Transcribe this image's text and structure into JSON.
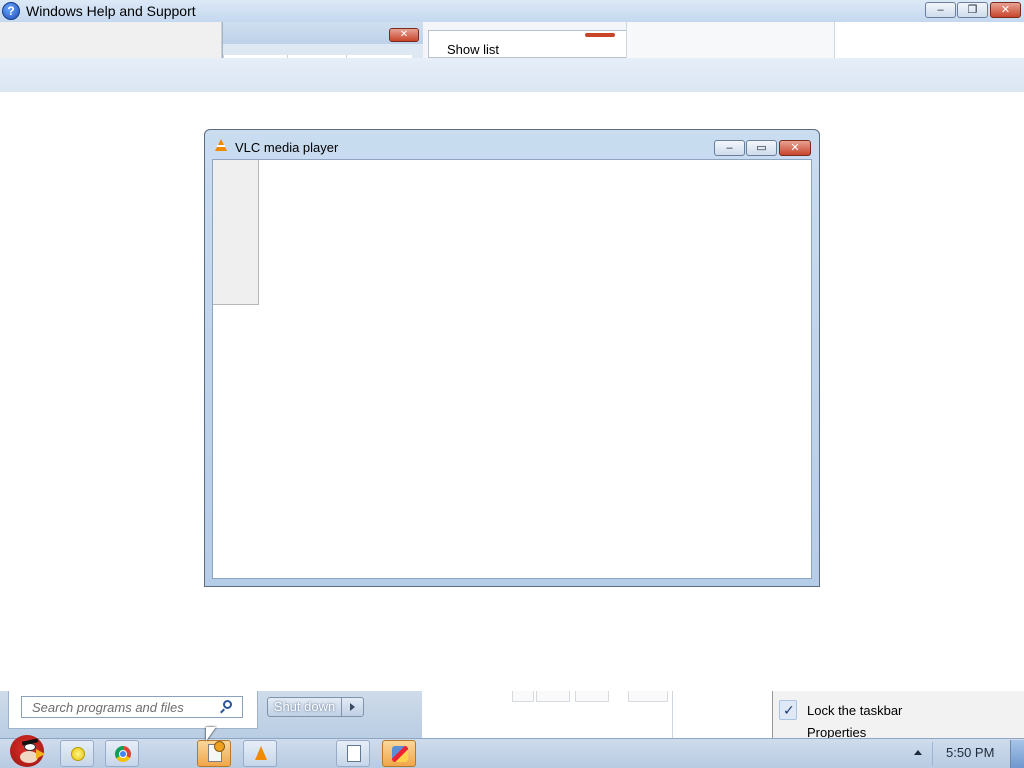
{
  "help_window": {
    "title": "Windows Help and Support",
    "icon": "help-icon",
    "caption_buttons": {
      "minimize": "‒",
      "restore": "❐",
      "close": "✕"
    },
    "inner_window": {
      "close_glyph": "✕"
    },
    "list_pane": {
      "label": "Show list"
    }
  },
  "vlc_window": {
    "title": "VLC media player",
    "icon": "vlc-cone-icon",
    "caption_buttons": {
      "minimize": "‒",
      "maximize": "▭",
      "close": "✕"
    }
  },
  "start_menu": {
    "search": {
      "placeholder": "Search programs and files",
      "value": ""
    },
    "shutdown_label": "Shut down"
  },
  "context_menu": {
    "items": [
      {
        "label": "Lock the taskbar",
        "checked": true
      },
      {
        "label": "Properties"
      }
    ],
    "check_glyph": "✓"
  },
  "taskbar": {
    "start_orb": "angry-bird-start-icon",
    "buttons": [
      {
        "name": "sun-app",
        "icon": "sun-icon"
      },
      {
        "name": "chrome",
        "icon": "chrome-icon"
      },
      {
        "name": "active-document",
        "icon": "document-icon",
        "active": true
      },
      {
        "name": "vlc",
        "icon": "vlc-cone-icon"
      },
      {
        "name": "notepad",
        "icon": "notepad-icon"
      },
      {
        "name": "paint",
        "icon": "paint-icon",
        "active": true
      }
    ],
    "clock": "5:50 PM"
  },
  "colors": {
    "accent_titlebar": "#c4d8ef",
    "close_red": "#c8452c",
    "active_task_orange": "#f0a64a",
    "vlc_orange": "#f08a00"
  }
}
